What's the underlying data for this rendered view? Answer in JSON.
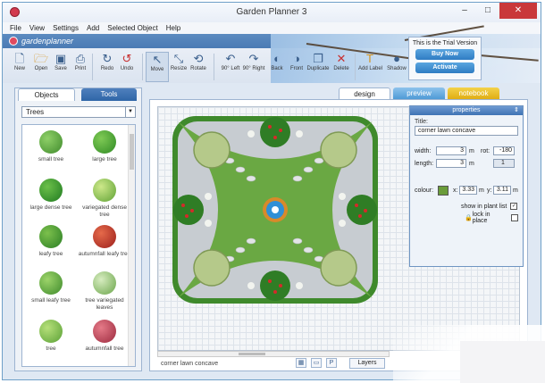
{
  "window": {
    "title": "Garden Planner 3",
    "controls": [
      "–",
      "□",
      "✕"
    ]
  },
  "menu": [
    "File",
    "View",
    "Settings",
    "Add",
    "Selected Object",
    "Help"
  ],
  "logo": {
    "text": "gardenplanner"
  },
  "toolbar": [
    {
      "label": "New",
      "icon": "new-file-icon"
    },
    {
      "label": "Open",
      "icon": "folder-open-icon"
    },
    {
      "label": "Save",
      "icon": "save-icon"
    },
    {
      "label": "Print",
      "icon": "print-icon"
    },
    {
      "label": "Redo",
      "icon": "redo-icon"
    },
    {
      "label": "Undo",
      "icon": "undo-icon"
    },
    {
      "label": "Move",
      "icon": "cursor-icon"
    },
    {
      "label": "Resize",
      "icon": "resize-icon"
    },
    {
      "label": "Rotate",
      "icon": "rotate-icon"
    },
    {
      "label": "90° Left",
      "icon": "rotate-left-icon"
    },
    {
      "label": "90° Right",
      "icon": "rotate-right-icon"
    },
    {
      "label": "Back",
      "icon": "send-back-icon"
    },
    {
      "label": "Front",
      "icon": "bring-front-icon"
    },
    {
      "label": "Duplicate",
      "icon": "duplicate-icon"
    },
    {
      "label": "Delete",
      "icon": "delete-icon"
    },
    {
      "label": "Add Label",
      "icon": "add-label-icon"
    },
    {
      "label": "Shadow",
      "icon": "shadow-icon"
    }
  ],
  "trial": {
    "text": "This is the Trial Version",
    "buy": "Buy Now",
    "activate": "Activate"
  },
  "left_tabs": {
    "objects": "Objects",
    "tools": "Tools"
  },
  "category": "Trees",
  "objects": [
    {
      "name": "small tree",
      "color": "#4f9e3a"
    },
    {
      "name": "large tree",
      "color": "#3f9a2f"
    },
    {
      "name": "large dense tree",
      "color": "#2f8f2a"
    },
    {
      "name": "variegated dense tree",
      "color": "#7fb847"
    },
    {
      "name": "leafy tree",
      "color": "#3b8e33"
    },
    {
      "name": "autumnfall leafy tree",
      "color": "#c0392b"
    },
    {
      "name": "small leafy tree",
      "color": "#5a9c3c"
    },
    {
      "name": "tree variegated leaves",
      "color": "#8ab86a"
    },
    {
      "name": "tree",
      "color": "#7cbf4e"
    },
    {
      "name": "autumnfall tree",
      "color": "#c04858"
    }
  ],
  "view_tabs": {
    "design": "design",
    "preview": "preview",
    "notebook": "notebook"
  },
  "properties": {
    "header": "properties",
    "title_label": "Title:",
    "title_value": "corner lawn  concave",
    "width_label": "width:",
    "width_value": "3",
    "width_unit": "m",
    "rot_label": "rot:",
    "rot_value": "-180",
    "length_label": "length:",
    "length_value": "3",
    "length_unit": "m",
    "page_value": "1",
    "colour_label": "colour:",
    "colour": "#6a9c3a",
    "x_label": "x:",
    "x_value": "3.33",
    "x_unit": "m",
    "y_label": "y:",
    "y_value": "3.11",
    "y_unit": "m",
    "show_in_plant_list": "show in plant list",
    "lock_in_place": "lock in place"
  },
  "status": {
    "text": "corner lawn  concave",
    "layers": "Layers"
  }
}
